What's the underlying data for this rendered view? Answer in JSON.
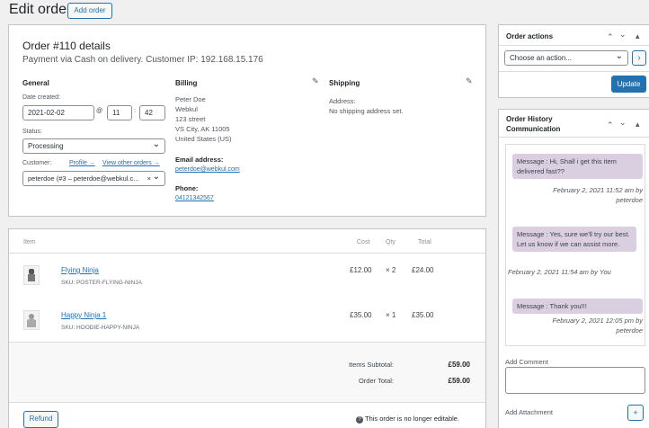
{
  "page": {
    "title": "Edit order",
    "add_order_label": "Add order"
  },
  "order": {
    "title": "Order #110 details",
    "subtitle": "Payment via Cash on delivery. Customer IP: 192.168.15.176",
    "general": {
      "heading": "General",
      "date_label": "Date created:",
      "date_value": "2021-02-02",
      "at": "@",
      "hour": "11",
      "minute": "42",
      "colon": ":",
      "status_label": "Status:",
      "status_value": "Processing",
      "customer_label": "Customer:",
      "profile_link": "Profile →",
      "other_orders_link": "View other orders →",
      "customer_value": "peterdoe (#3 – peterdoe@webkul.c...",
      "customer_clear": "×"
    },
    "billing": {
      "heading": "Billing",
      "address_lines": [
        "Peter Doe",
        "Webkul",
        "123 street",
        "VS City, AK 11005",
        "United States (US)"
      ],
      "email_label": "Email address:",
      "email": "peterdoe@webkul.com",
      "phone_label": "Phone:",
      "phone": "04121342567"
    },
    "shipping": {
      "heading": "Shipping",
      "address_label": "Address:",
      "address_value": "No shipping address set."
    }
  },
  "items": {
    "headers": {
      "item": "Item",
      "cost": "Cost",
      "qty": "Qty",
      "total": "Total"
    },
    "rows": [
      {
        "name": "Flying Ninja",
        "sku": "SKU: POSTER-FLYING-NINJA",
        "cost": "£12.00",
        "qty": "× 2",
        "total": "£24.00"
      },
      {
        "name": "Happy Ninja 1",
        "sku": "SKU: HOODIE-HAPPY-NINJA",
        "cost": "£35.00",
        "qty": "× 1",
        "total": "£35.00"
      }
    ],
    "subtotal_label": "Items Subtotal:",
    "subtotal": "£59.00",
    "order_total_label": "Order Total:",
    "order_total": "£59.00",
    "refund_label": "Refund",
    "not_editable_note": "This order is no longer editable."
  },
  "order_actions": {
    "title": "Order actions",
    "select_placeholder": "Choose an action...",
    "go": "›",
    "update_label": "Update"
  },
  "history": {
    "title": "Order History Communication",
    "messages": [
      {
        "text": "Message : Hi, Shall i get this item delivered fast??",
        "meta": "February 2, 2021 11:52 am by peterdoe"
      },
      {
        "text": "Message : Yes, sure we'll try our best. Let us know if we can assist more.",
        "meta": "February 2, 2021 11:54 am by You"
      },
      {
        "text": "Message : Thank you!!!",
        "meta": "February 2, 2021 12:05 pm by peterdoe"
      }
    ],
    "add_comment_label": "Add Comment",
    "add_attachment_label": "Add Attachment",
    "add_attachment_button": "+"
  },
  "colors": {
    "accent": "#2271b1",
    "bubble": "#d9cfe0"
  }
}
